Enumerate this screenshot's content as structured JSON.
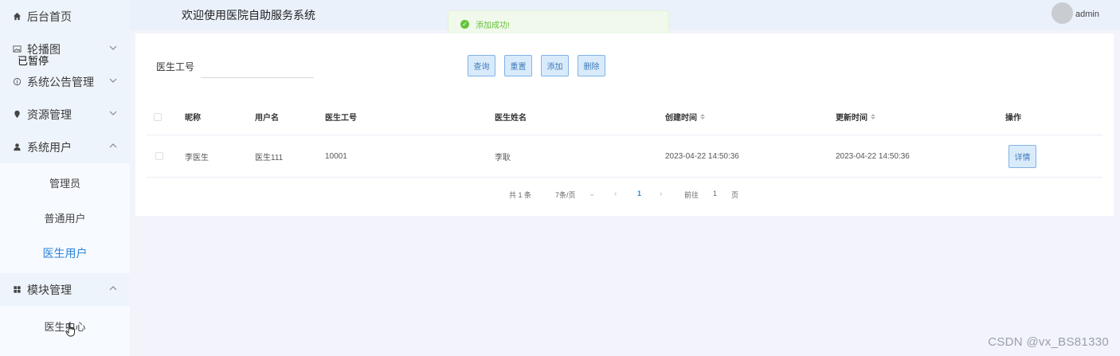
{
  "header": {
    "title": "欢迎使用医院自助服务系统",
    "username": "admin"
  },
  "toast": {
    "message": "添加成功!",
    "color": "#67c23a"
  },
  "sidebar": {
    "items": [
      {
        "label": "后台首页",
        "icon": "home-icon"
      },
      {
        "label": "轮播图",
        "icon": "image-icon"
      },
      {
        "label": "系统公告管理",
        "icon": "info-icon"
      },
      {
        "label": "资源管理",
        "icon": "location-icon"
      },
      {
        "label": "系统用户",
        "icon": "user-icon"
      },
      {
        "label": "模块管理",
        "icon": "grid-icon"
      }
    ],
    "overlay_text": "已暂停",
    "user_sub": [
      {
        "label": "管理员"
      },
      {
        "label": "普通用户"
      },
      {
        "label": "医生用户"
      }
    ],
    "module_sub": [
      {
        "label": "医生中心"
      }
    ],
    "active_color": "#2d84d8"
  },
  "search": {
    "label": "医生工号",
    "value": "",
    "placeholder": ""
  },
  "buttons": {
    "query": "查询",
    "reset": "重置",
    "add": "添加",
    "delete": "删除"
  },
  "table": {
    "headers": [
      "昵称",
      "用户名",
      "医生工号",
      "医生姓名",
      "创建时间",
      "更新时间",
      "操作"
    ],
    "rows": [
      {
        "nickname": "李医生",
        "username": "医生111",
        "doctor_id": "10001",
        "doctor_name": "李耿",
        "created": "2023-04-22 14:50:36",
        "updated": "2023-04-22 14:50:36",
        "action": "详情"
      }
    ]
  },
  "pagination": {
    "total": "共 1 条",
    "page_size": "7条/页",
    "current_page": "1",
    "goto_prefix": "前往",
    "goto_value": "1",
    "goto_suffix": "页"
  },
  "watermark": "CSDN @vx_BS81330"
}
